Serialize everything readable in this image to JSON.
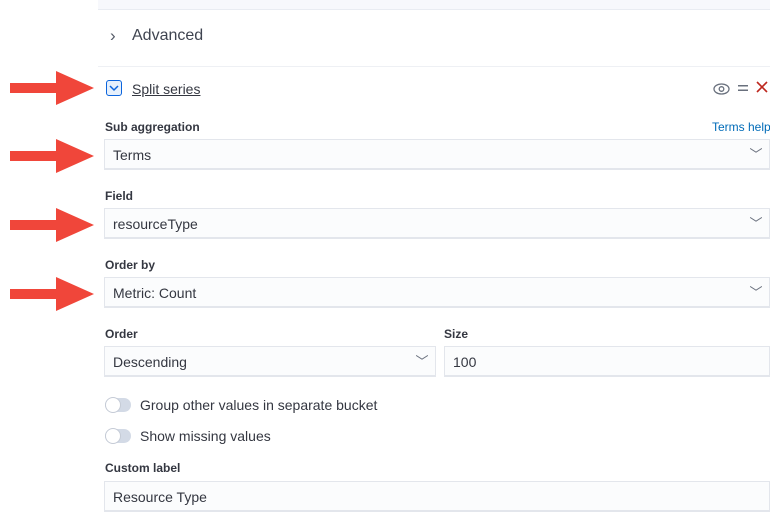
{
  "advanced": {
    "label": "Advanced"
  },
  "split": {
    "title": "Split series",
    "help_link": "Terms help",
    "fields": {
      "sub_aggregation": {
        "label": "Sub aggregation",
        "value": "Terms"
      },
      "field": {
        "label": "Field",
        "value": "resourceType"
      },
      "order_by": {
        "label": "Order by",
        "value": "Metric: Count"
      },
      "order": {
        "label": "Order",
        "value": "Descending"
      },
      "size": {
        "label": "Size",
        "value": "100"
      },
      "custom_label": {
        "label": "Custom label",
        "value": "Resource Type"
      }
    },
    "switches": {
      "group_other": {
        "label": "Group other values in separate bucket",
        "checked": false
      },
      "show_missing": {
        "label": "Show missing values",
        "checked": false
      }
    }
  },
  "colors": {
    "arrow": "#f0463a",
    "accent": "#0b64dd",
    "danger": "#bd271e",
    "link": "#006bb8"
  },
  "icons": [
    "chevron-right-icon",
    "chevron-down-icon",
    "eye-icon",
    "drag-handle-icon",
    "cross-icon",
    "arrow-right-icon"
  ]
}
